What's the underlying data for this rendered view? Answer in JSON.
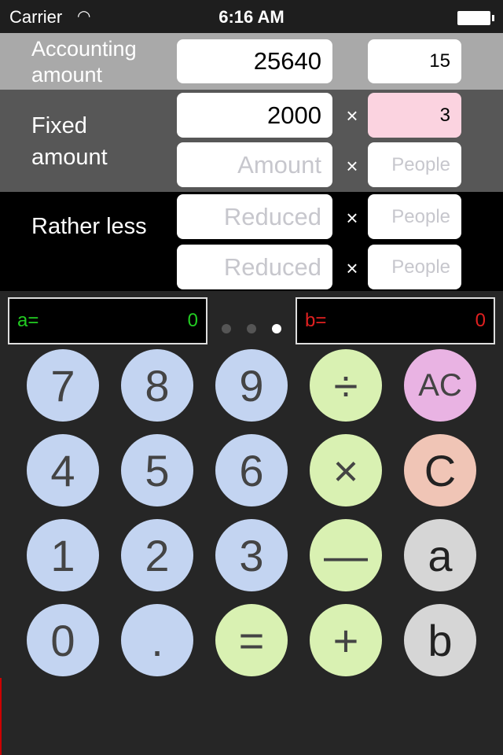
{
  "status": {
    "carrier": "Carrier",
    "wifi_icon": "wifi-icon",
    "time": "6:16 AM",
    "battery_icon": "battery-icon"
  },
  "accounting": {
    "label": "Accounting amount",
    "amount": "25640",
    "people": "15"
  },
  "fixed": {
    "label": "Fixed amount",
    "rows": [
      {
        "amount": "2000",
        "people": "3",
        "amount_placeholder": "Amount",
        "people_placeholder": "People"
      },
      {
        "amount": "",
        "people": "",
        "amount_placeholder": "Amount",
        "people_placeholder": "People"
      }
    ]
  },
  "rather": {
    "label": "Rather less",
    "rows": [
      {
        "amount_placeholder": "Reduced",
        "people_placeholder": "People"
      },
      {
        "amount_placeholder": "Reduced",
        "people_placeholder": "People"
      }
    ]
  },
  "times": "×",
  "display": {
    "a_label": "a=",
    "a_value": "0",
    "b_label": "b=",
    "b_value": "0",
    "a_color": "#22cc22",
    "b_color": "#e02020",
    "page_count": 3,
    "current_page": 3
  },
  "keys": [
    [
      "7",
      "8",
      "9",
      "÷",
      "AC"
    ],
    [
      "4",
      "5",
      "6",
      "×",
      "C"
    ],
    [
      "1",
      "2",
      "3",
      "—",
      "a"
    ],
    [
      "0",
      ".",
      "=",
      "+",
      "b"
    ]
  ],
  "colors": {
    "digit": "#c3d4f1",
    "operator": "#d9f1b2",
    "ac": "#e9b3e3",
    "c": "#f0c5b6",
    "memory": "#d6d6d6",
    "people_highlight": "#fbd3e0"
  }
}
